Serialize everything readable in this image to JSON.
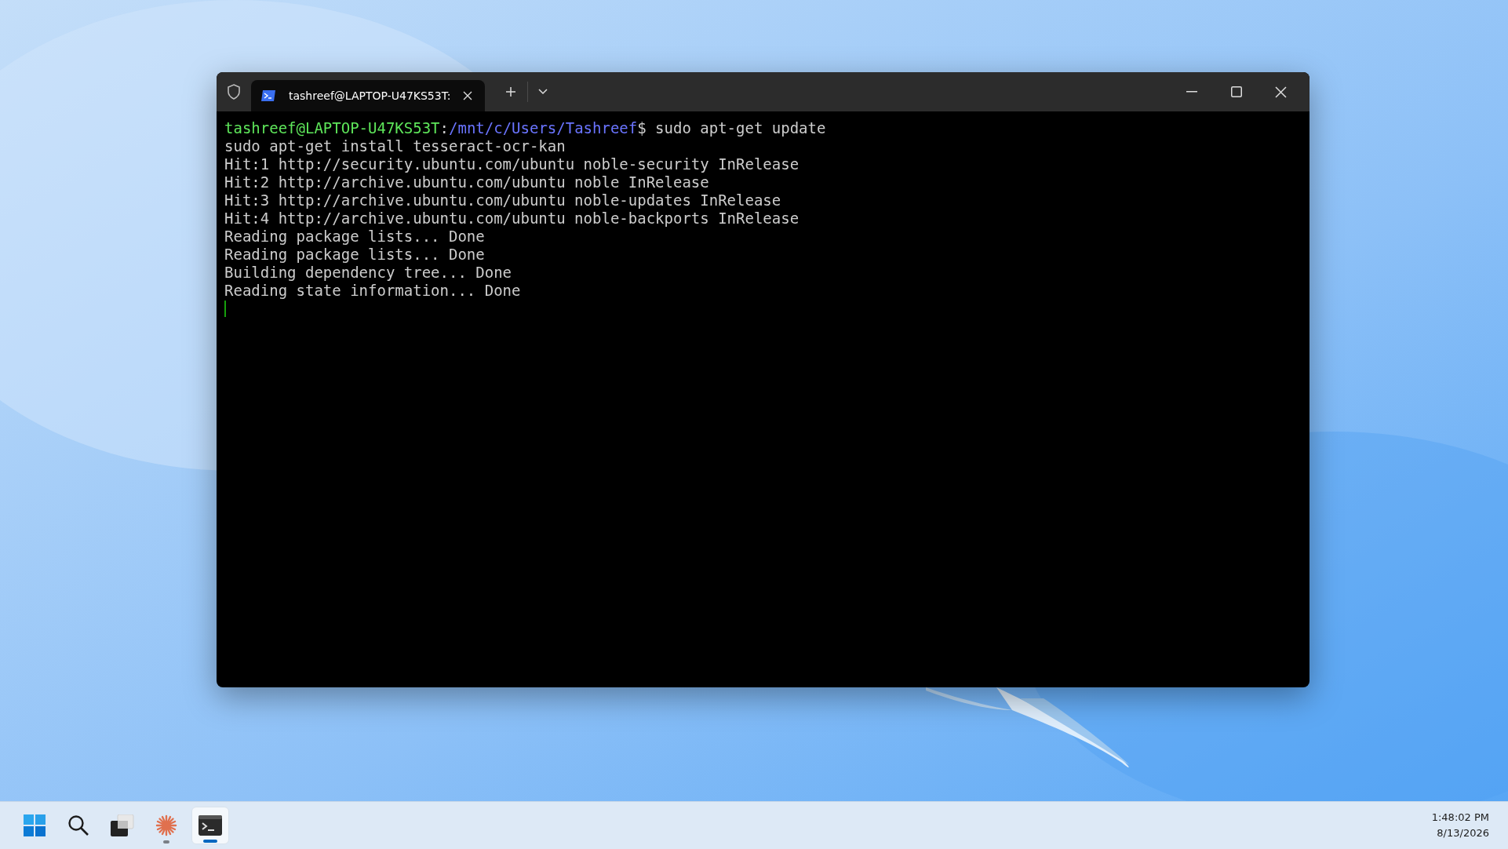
{
  "window": {
    "tabs": [
      {
        "title": "tashreef@LAPTOP-U47KS53T:",
        "selected": true
      }
    ]
  },
  "terminal": {
    "lines": [
      {
        "segments": [
          {
            "kind": "user",
            "text": "tashreef@LAPTOP-U47KS53T"
          },
          {
            "kind": "plain",
            "text": ":"
          },
          {
            "kind": "path",
            "text": "/mnt/c/Users/Tashreef"
          },
          {
            "kind": "plain",
            "text": "$ sudo apt-get update"
          }
        ]
      },
      {
        "segments": [
          {
            "kind": "plain",
            "text": "sudo apt-get install tesseract-ocr-kan"
          }
        ]
      },
      {
        "segments": [
          {
            "kind": "plain",
            "text": "Hit:1 http://security.ubuntu.com/ubuntu noble-security InRelease"
          }
        ]
      },
      {
        "segments": [
          {
            "kind": "plain",
            "text": "Hit:2 http://archive.ubuntu.com/ubuntu noble InRelease"
          }
        ]
      },
      {
        "segments": [
          {
            "kind": "plain",
            "text": "Hit:3 http://archive.ubuntu.com/ubuntu noble-updates InRelease"
          }
        ]
      },
      {
        "segments": [
          {
            "kind": "plain",
            "text": "Hit:4 http://archive.ubuntu.com/ubuntu noble-backports InRelease"
          }
        ]
      },
      {
        "segments": [
          {
            "kind": "plain",
            "text": "Reading package lists... Done"
          }
        ]
      },
      {
        "segments": [
          {
            "kind": "plain",
            "text": "Reading package lists... Done"
          }
        ]
      },
      {
        "segments": [
          {
            "kind": "plain",
            "text": "Building dependency tree... Done"
          }
        ]
      },
      {
        "segments": [
          {
            "kind": "plain",
            "text": "Reading state information... Done"
          }
        ]
      }
    ]
  },
  "taskbar": {
    "apps": [
      {
        "kind": "start",
        "running": false,
        "active": false
      },
      {
        "kind": "search",
        "running": false,
        "active": false
      },
      {
        "kind": "task-view",
        "running": false,
        "active": false
      },
      {
        "kind": "starburst",
        "running": true,
        "active": false
      },
      {
        "kind": "terminal",
        "running": true,
        "active": true
      }
    ],
    "clock": {
      "time": "1:48:02 PM",
      "date": "8/13/2026"
    }
  }
}
